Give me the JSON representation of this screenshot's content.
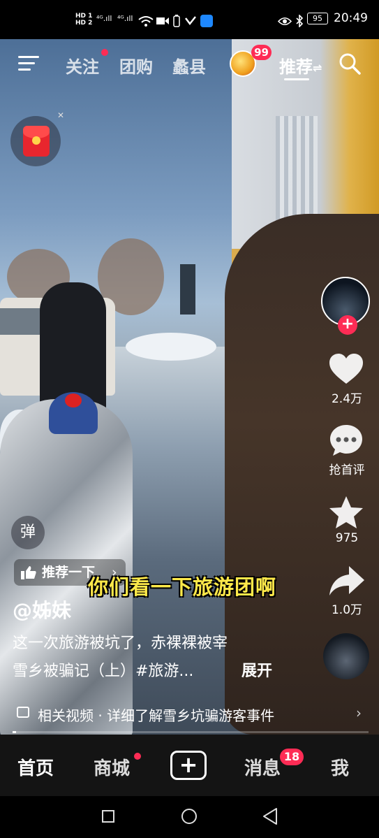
{
  "status_bar": {
    "left_icons": [
      "HD 1",
      "HD 2",
      "4G",
      "4G",
      "5G",
      "wifi-icon",
      "camera-icon",
      "battery-saver-icon",
      "app-icon",
      "app-icon"
    ],
    "hd1": "HD 1",
    "hd2": "HD 2",
    "sig1": "⁴ᴳ.ıll",
    "sig2": "⁴ᴳ.ıll",
    "battery": "95",
    "time": "20:49"
  },
  "top_nav": {
    "tabs": [
      {
        "label": "关注",
        "has_dot": true
      },
      {
        "label": "团购"
      },
      {
        "label": "蠡县"
      },
      {
        "label": "推荐",
        "active": true,
        "suffix": "⇌"
      }
    ],
    "avatar_badge": "99"
  },
  "right_rail": {
    "like_count": "2.4万",
    "comment_label": "抢首评",
    "favorite_count": "975",
    "share_count": "1.0万"
  },
  "video": {
    "danmaku_label": "弹",
    "recommend_label": "推荐一下",
    "subtitle": "你们看一下旅游团啊",
    "author": "@姊妹",
    "description_line1": "这一次旅游被坑了，赤裸裸被宰",
    "description_line2": "雪乡被骗记（上）#旅游...",
    "expand_label": "展开",
    "related_text": "相关视频 · 详细了解雪乡坑骗游客事件",
    "progress_fraction": 0.01
  },
  "bottom_nav": {
    "home": "首页",
    "mall": "商城",
    "messages": "消息",
    "messages_badge": "18",
    "me": "我"
  },
  "colors": {
    "accent": "#fe2c55",
    "subtitle_yellow": "#ffe94a",
    "bottom_bar": "#141414"
  }
}
